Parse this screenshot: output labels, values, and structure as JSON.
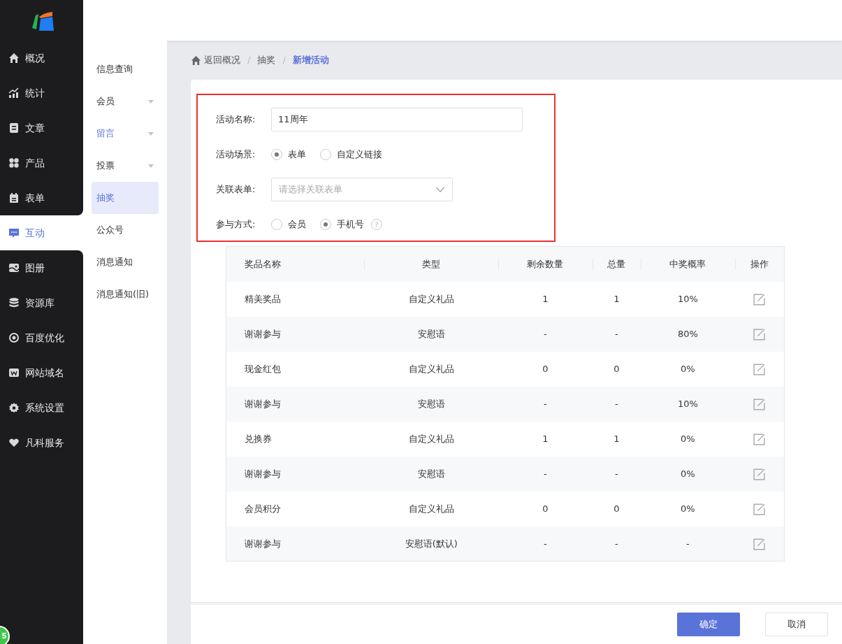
{
  "sidebar": {
    "items": [
      {
        "label": "概况",
        "selected": false
      },
      {
        "label": "统计",
        "selected": false
      },
      {
        "label": "文章",
        "selected": false
      },
      {
        "label": "产品",
        "selected": false
      },
      {
        "label": "表单",
        "selected": false
      },
      {
        "label": "互动",
        "selected": true
      },
      {
        "label": "图册",
        "selected": false
      },
      {
        "label": "资源库",
        "selected": false
      },
      {
        "label": "百度优化",
        "selected": false
      },
      {
        "label": "网站域名",
        "selected": false
      },
      {
        "label": "系统设置",
        "selected": false
      },
      {
        "label": "凡科服务",
        "selected": false
      }
    ]
  },
  "submenu": {
    "items": [
      {
        "label": "信息查询",
        "selected": false,
        "expandable": false,
        "highlighted": false
      },
      {
        "label": "会员",
        "selected": false,
        "expandable": true,
        "highlighted": false
      },
      {
        "label": "留言",
        "selected": false,
        "expandable": true,
        "highlighted": true
      },
      {
        "label": "投票",
        "selected": false,
        "expandable": true,
        "highlighted": false
      },
      {
        "label": "抽奖",
        "selected": true,
        "expandable": false,
        "highlighted": false
      },
      {
        "label": "公众号",
        "selected": false,
        "expandable": false,
        "highlighted": false
      },
      {
        "label": "消息通知",
        "selected": false,
        "expandable": false,
        "highlighted": false
      },
      {
        "label": "消息通知(旧)",
        "selected": false,
        "expandable": false,
        "highlighted": false
      }
    ]
  },
  "breadcrumb": [
    {
      "label": "返回概况"
    },
    {
      "separator": "/",
      "label": "抽奖"
    },
    {
      "separator": "/",
      "label": "新增活动"
    }
  ],
  "form": {
    "name": {
      "label": "活动名称:",
      "value": "11周年"
    },
    "scene": {
      "label": "活动场景:",
      "options": [
        {
          "label": "表单",
          "selected": true
        },
        {
          "label": "自定义链接",
          "selected": false
        }
      ]
    },
    "linked_form": {
      "label": "关联表单:",
      "placeholder": "请选择关联表单"
    },
    "participation": {
      "label": "参与方式:",
      "options": [
        {
          "label": "会员",
          "selected": false
        },
        {
          "label": "手机号",
          "selected": true
        }
      ],
      "help": "?"
    }
  },
  "table": {
    "columns": [
      "奖品名称",
      "类型",
      "剩余数量",
      "总量",
      "中奖概率",
      "操作"
    ],
    "rows": [
      [
        "精美奖品",
        "自定义礼品",
        "1",
        "1",
        "10%"
      ],
      [
        "谢谢参与",
        "安慰语",
        "-",
        "-",
        "80%"
      ],
      [
        "现金红包",
        "自定义礼品",
        "0",
        "0",
        "0%"
      ],
      [
        "谢谢参与",
        "安慰语",
        "-",
        "-",
        "10%"
      ],
      [
        "兑换券",
        "自定义礼品",
        "1",
        "1",
        "0%"
      ],
      [
        "谢谢参与",
        "安慰语",
        "-",
        "-",
        "0%"
      ],
      [
        "会员积分",
        "自定义礼品",
        "0",
        "0",
        "0%"
      ],
      [
        "谢谢参与",
        "安慰语(默认)",
        "-",
        "-",
        "-"
      ]
    ]
  },
  "buttons": {
    "confirm": "确定",
    "cancel": "取消"
  },
  "badge": "5"
}
